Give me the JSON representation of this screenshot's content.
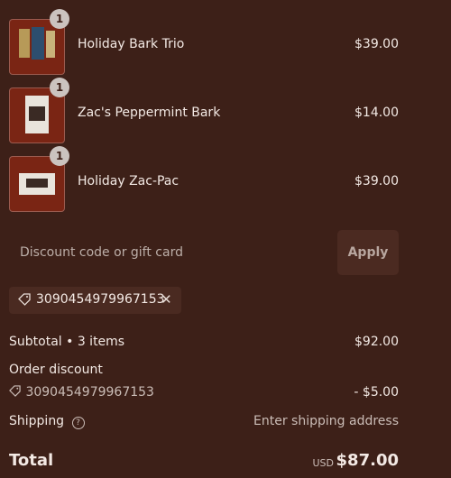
{
  "items": [
    {
      "name": "Holiday Bark Trio",
      "price": "$39.00",
      "qty": "1",
      "icon": "product-thumbnail"
    },
    {
      "name": "Zac's Peppermint Bark",
      "price": "$14.00",
      "qty": "1",
      "icon": "product-thumbnail"
    },
    {
      "name": "Holiday Zac-Pac",
      "price": "$39.00",
      "qty": "1",
      "icon": "product-thumbnail"
    }
  ],
  "discount": {
    "placeholder": "Discount code or gift card",
    "apply_label": "Apply",
    "applied_code": "3090454979967153",
    "tag_icon": "tag-icon",
    "remove_icon": "close-icon"
  },
  "summary": {
    "subtotal_label": "Subtotal • 3 items",
    "subtotal_value": "$92.00",
    "order_discount_label": "Order discount",
    "discount_code": "3090454979967153",
    "discount_value": "- $5.00",
    "shipping_label": "Shipping",
    "shipping_value": "Enter shipping address",
    "total_label": "Total",
    "currency": "USD",
    "total_value": "$87.00"
  },
  "colors": {
    "background": "#3d2018",
    "text": "#f3e9e4",
    "muted_text": "#cbbdb7",
    "badge": "#cbc3bf",
    "thumbnail_bg": "#7a2514"
  }
}
